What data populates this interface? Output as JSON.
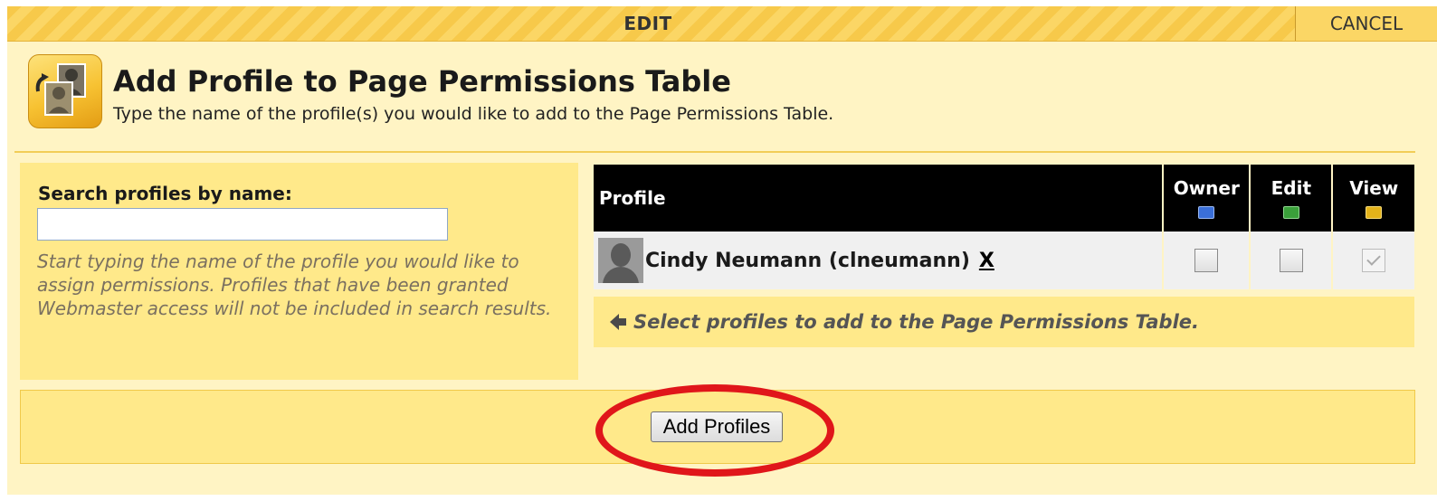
{
  "topbar": {
    "title": "EDIT",
    "cancel_label": "CANCEL"
  },
  "header": {
    "icon": "profile-swap-icon",
    "title": "Add Profile to Page Permissions Table",
    "subtitle": "Type the name of the profile(s) you would like to add to the Page Permissions Table."
  },
  "search": {
    "label": "Search profiles by name:",
    "value": "",
    "placeholder": "",
    "help": "Start typing the name of the profile you would like to assign permissions. Profiles that have been granted Webmaster access will not be included in search results."
  },
  "table": {
    "columns": {
      "profile": "Profile",
      "owner": "Owner",
      "edit": "Edit",
      "view": "View"
    },
    "column_icons": {
      "owner": "owner-icon",
      "edit": "edit-pencil-icon",
      "view": "view-eye-icon"
    },
    "rows": [
      {
        "name": "Cindy Neumann (clneumann)",
        "remove_label": "X",
        "owner": false,
        "edit": false,
        "view": true
      }
    ],
    "hint": "Select profiles to add to the Page Permissions Table."
  },
  "footer": {
    "add_button_label": "Add Profiles"
  },
  "colors": {
    "panel_bg": "#fff4c4",
    "box_bg": "#ffe98a",
    "stripe_a": "#f7c94a",
    "stripe_b": "#fbd665",
    "highlight": "#e0161a"
  }
}
